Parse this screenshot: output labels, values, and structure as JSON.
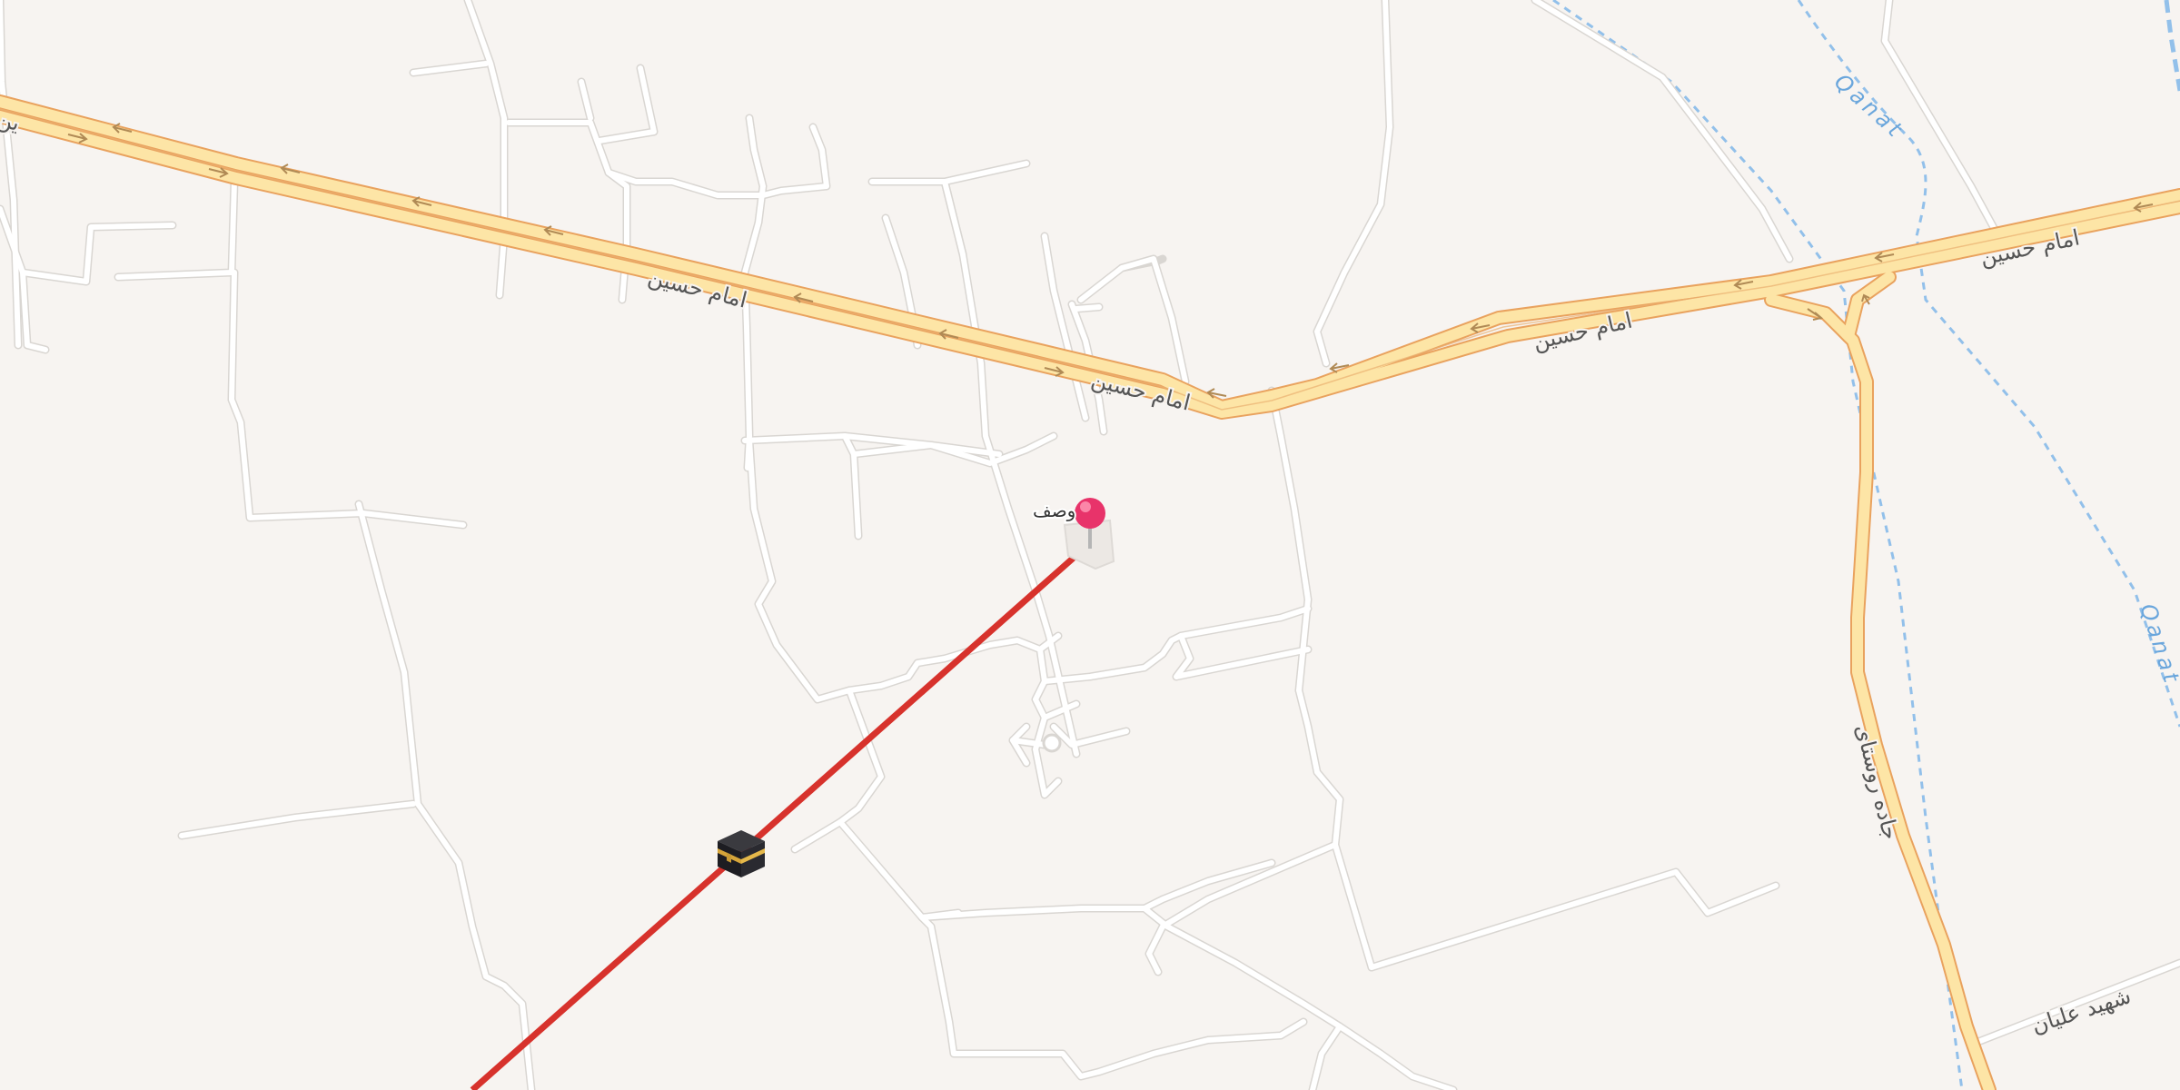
{
  "map": {
    "background_color": "#f7f4f1",
    "major_road_color": "#fde5a6",
    "minor_road_color": "#ffffff",
    "water_color": "#92c0ea",
    "qibla_line_color": "#d7322c",
    "pin_color": "#e8336a"
  },
  "labels": {
    "road_top_left_1": "امام حسین",
    "road_top_left_2": "امام حسین",
    "road_top_left_edge": "ین",
    "road_right_1": "امام حسین",
    "road_right_2": "امام حسین",
    "road_vertical_right": "جاده روستای",
    "road_bottom_right": "شهید علیان",
    "water_top": "Qanat",
    "water_right": "Qanat",
    "place_pin": "وصف"
  },
  "icons": {
    "location_pin": "location-pin-icon",
    "kaaba": "kaaba-icon"
  }
}
